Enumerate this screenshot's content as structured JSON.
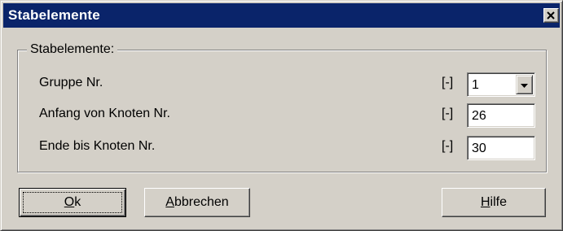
{
  "window": {
    "title": "Stabelemente",
    "close_icon": "close-icon"
  },
  "group": {
    "legend": "Stabelemente:",
    "rows": [
      {
        "label": "Gruppe Nr.",
        "unit": "[-]",
        "value": "1",
        "control": "combobox"
      },
      {
        "label": "Anfang von Knoten Nr.",
        "unit": "[-]",
        "value": "26",
        "control": "textfield"
      },
      {
        "label": "Ende bis Knoten Nr.",
        "unit": "[-]",
        "value": "30",
        "control": "textfield"
      }
    ]
  },
  "buttons": {
    "ok": {
      "mnemonic": "O",
      "rest": "k"
    },
    "cancel": {
      "mnemonic": "A",
      "rest": "bbrechen"
    },
    "help": {
      "mnemonic": "H",
      "rest": "ilfe"
    }
  },
  "colors": {
    "titlebar": "#0a246a",
    "face": "#d4d0c8"
  }
}
